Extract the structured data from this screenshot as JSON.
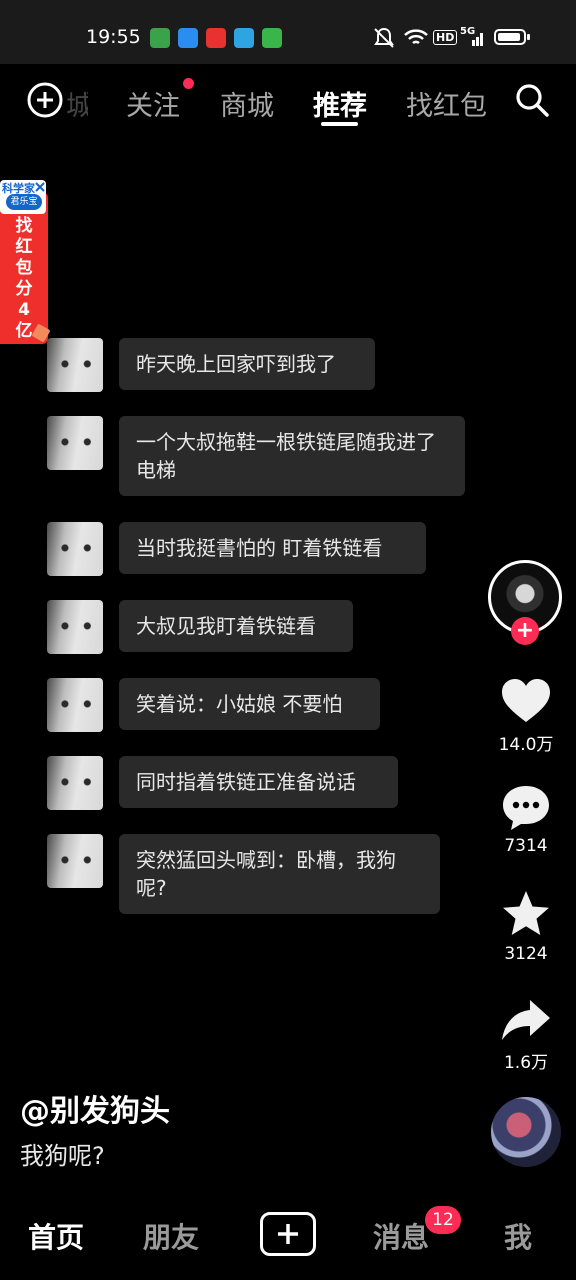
{
  "status_bar": {
    "time": "19:55",
    "app_icons": [
      {
        "name": "shop-app-icon",
        "color": "#3aa34a"
      },
      {
        "name": "bubble-app-icon",
        "color": "#2a8ef0"
      },
      {
        "name": "taobao-app-icon",
        "color": "#e8322f"
      },
      {
        "name": "telegram-app-icon",
        "color": "#2fa4e2"
      },
      {
        "name": "green-app-icon",
        "color": "#39b54a"
      }
    ],
    "network_labels": {
      "hd": "HD",
      "gen": "5G"
    }
  },
  "top_nav": {
    "add_icon": "plus-circle-icon",
    "faded_label": "城",
    "tabs": [
      {
        "label": "关注",
        "active": false,
        "has_dot": true
      },
      {
        "label": "商城",
        "active": false
      },
      {
        "label": "推荐",
        "active": true
      },
      {
        "label": "找红包",
        "active": false
      }
    ],
    "search_icon": "search-icon"
  },
  "banner": {
    "top_text": "科学家",
    "brand": "君乐宝",
    "text": "找红包分4亿",
    "close_icon": "close-icon"
  },
  "chat": {
    "messages": [
      {
        "text": "昨天晚上回家吓到我了"
      },
      {
        "text": "一个大叔拖鞋一根铁链尾随我进了电梯"
      },
      {
        "text": "当时我挺書怕的 盯着铁链看"
      },
      {
        "text": "大叔见我盯着铁链看"
      },
      {
        "text": "笑着说：小姑娘 不要怕"
      },
      {
        "text": "同时指着铁链正准备说话"
      },
      {
        "text": "突然猛回头喊到：卧槽，我狗呢?"
      }
    ]
  },
  "actions": {
    "follow_plus": "+",
    "like_count": "14.0万",
    "comment_count": "7314",
    "favorite_count": "3124",
    "share_count": "1.6万"
  },
  "video_info": {
    "username": "@别发狗头",
    "caption": "我狗呢?"
  },
  "bottom_bar": {
    "tabs": [
      {
        "label": "首页",
        "active": true
      },
      {
        "label": "朋友",
        "active": false
      },
      {
        "label": "消息",
        "active": false
      },
      {
        "label": "我",
        "active": false
      }
    ],
    "create_icon": "plus-icon",
    "message_badge": "12"
  },
  "colors": {
    "accent": "#fe2c55",
    "bubble": "#2a2a2a",
    "banner": "#ee2f2b"
  }
}
